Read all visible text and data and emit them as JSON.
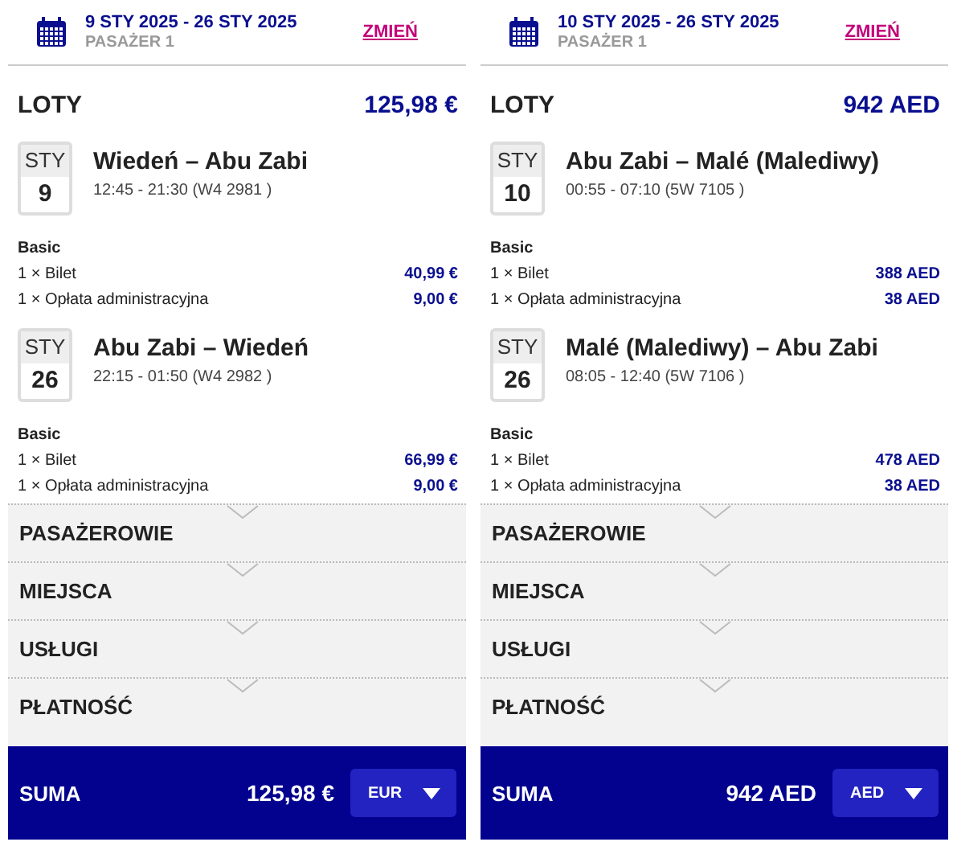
{
  "panels": [
    {
      "header": {
        "dates": "9 STY 2025 - 26 STY 2025",
        "passengers": "PASAŻER 1",
        "change_link": "ZMIEŃ"
      },
      "flights_label": "LOTY",
      "flights_total": "125,98 €",
      "flights": [
        {
          "month": "STY",
          "day": "9",
          "route": "Wiedeń – Abu Zabi",
          "times": "12:45 - 21:30 (W4 2981 )",
          "fare": "Basic",
          "lines": [
            {
              "label": "1 × Bilet",
              "price": "40,99 €"
            },
            {
              "label": "1 × Opłata administracyjna",
              "price": "9,00 €"
            }
          ]
        },
        {
          "month": "STY",
          "day": "26",
          "route": "Abu Zabi – Wiedeń",
          "times": "22:15 - 01:50 (W4 2982 )",
          "fare": "Basic",
          "lines": [
            {
              "label": "1 × Bilet",
              "price": "66,99 €"
            },
            {
              "label": "1 × Opłata administracyjna",
              "price": "9,00 €"
            }
          ]
        }
      ],
      "sections": [
        "PASAŻEROWIE",
        "MIEJSCA",
        "USŁUGI",
        "PŁATNOŚĆ"
      ],
      "total": {
        "label": "SUMA",
        "amount": "125,98 €",
        "currency": "EUR"
      }
    },
    {
      "header": {
        "dates": "10 STY 2025 - 26 STY 2025",
        "passengers": "PASAŻER 1",
        "change_link": "ZMIEŃ"
      },
      "flights_label": "LOTY",
      "flights_total": "942 AED",
      "flights": [
        {
          "month": "STY",
          "day": "10",
          "route": "Abu Zabi – Malé (Malediwy)",
          "times": "00:55 - 07:10 (5W 7105 )",
          "fare": "Basic",
          "lines": [
            {
              "label": "1 × Bilet",
              "price": "388 AED"
            },
            {
              "label": "1 × Opłata administracyjna",
              "price": "38 AED"
            }
          ]
        },
        {
          "month": "STY",
          "day": "26",
          "route": "Malé (Malediwy) – Abu Zabi",
          "times": "08:05 - 12:40 (5W 7106 )",
          "fare": "Basic",
          "lines": [
            {
              "label": "1 × Bilet",
              "price": "478 AED"
            },
            {
              "label": "1 × Opłata administracyjna",
              "price": "38 AED"
            }
          ]
        }
      ],
      "sections": [
        "PASAŻEROWIE",
        "MIEJSCA",
        "USŁUGI",
        "PŁATNOŚĆ"
      ],
      "total": {
        "label": "SUMA",
        "amount": "942 AED",
        "currency": "AED"
      }
    }
  ]
}
